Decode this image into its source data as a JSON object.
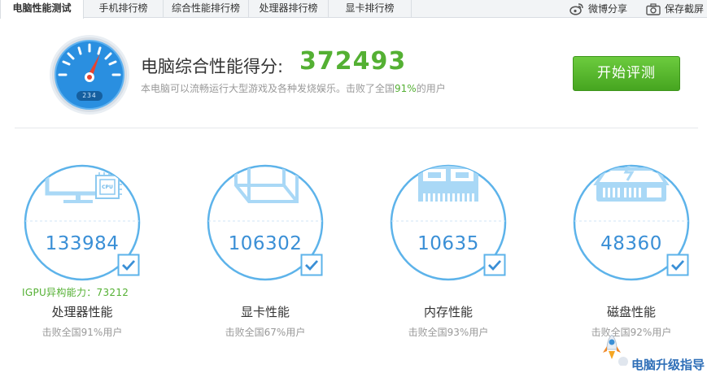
{
  "tabs": [
    {
      "label": "电脑性能测试",
      "active": true
    },
    {
      "label": "手机排行榜",
      "active": false
    },
    {
      "label": "综合性能排行榜",
      "active": false
    },
    {
      "label": "处理器排行榜",
      "active": false
    },
    {
      "label": "显卡排行榜",
      "active": false
    }
  ],
  "toolbar": {
    "weibo_share": "微博分享",
    "save_screenshot": "保存截屏"
  },
  "header": {
    "gauge_digits": "234",
    "score_label": "电脑综合性能得分:",
    "score_value": "372493",
    "subtitle_prefix": "本电脑可以流畅运行大型游戏及各种发烧娱乐。击败了全国",
    "subtitle_pct": "91%",
    "subtitle_suffix": "的用户",
    "start_button": "开始评测"
  },
  "cards": [
    {
      "name": "处理器性能",
      "value": "133984",
      "beat": "击败全国91%用户",
      "extra": "IGPU异构能力：73212",
      "icon": "monitor-cpu-icon",
      "chip_label": "CPU"
    },
    {
      "name": "显卡性能",
      "value": "106302",
      "beat": "击败全国67%用户",
      "icon": "graphics-cube-icon"
    },
    {
      "name": "内存性能",
      "value": "10635",
      "beat": "击败全国93%用户",
      "icon": "memory-module-icon"
    },
    {
      "name": "磁盘性能",
      "value": "48360",
      "beat": "击败全国92%用户",
      "icon": "disk-drive-icon"
    }
  ],
  "promo": {
    "text": "电脑升级指导"
  },
  "colors": {
    "accent_blue": "#3a8fd6",
    "circle_stroke": "#5db3ea",
    "score_green": "#54b033",
    "button_green": "#55b52c",
    "gauge_blue": "#2a8fe0",
    "needle_red": "#e8432f"
  }
}
